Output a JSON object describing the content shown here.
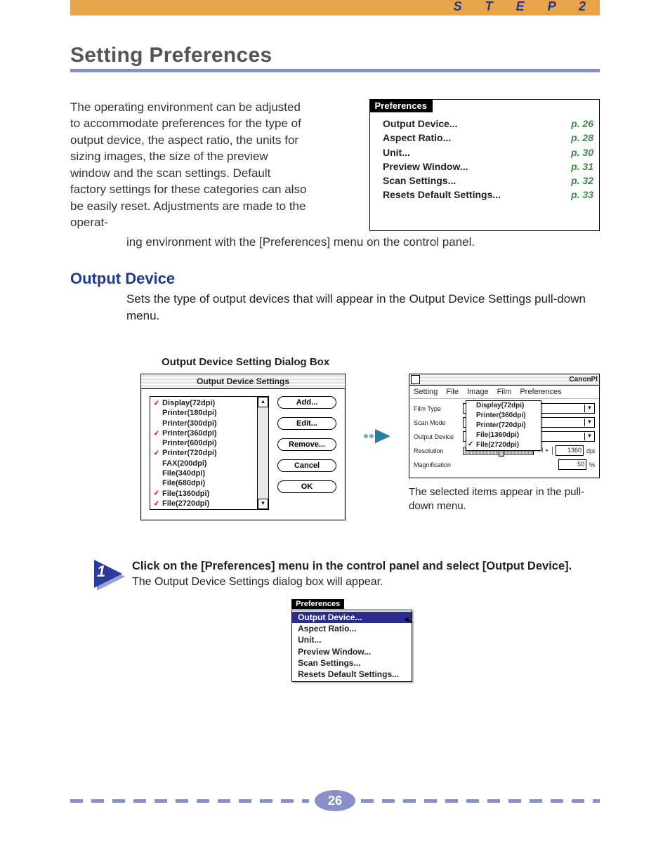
{
  "header": {
    "step_label": "S T E P  2",
    "title": "Setting Preferences"
  },
  "intro": {
    "para1": "The operating environment can be adjusted to accommodate preferences for the type of output device, the aspect ratio, the units for sizing images, the size of the preview window and the scan settings. Default factory settings for these categories can also be easily reset. Adjustments are made to the operat-",
    "para2": "ing environment with the [Preferences] menu on the control panel."
  },
  "pref_index": {
    "tab": "Preferences",
    "items": [
      {
        "label": "Output Device...",
        "page": "p. 26"
      },
      {
        "label": "Aspect Ratio...",
        "page": "p. 28"
      },
      {
        "label": "Unit...",
        "page": "p. 30"
      },
      {
        "label": "Preview Window...",
        "page": "p. 31"
      },
      {
        "label": "Scan Settings...",
        "page": "p. 32"
      },
      {
        "label": "Resets Default Settings...",
        "page": "p. 33"
      }
    ]
  },
  "subhead": {
    "title": "Output Device",
    "para": "Sets the type of output devices that will appear in the Output Device Settings pull-down menu."
  },
  "dialog": {
    "caption": "Output Device Setting Dialog Box",
    "title": "Output Device Settings",
    "items": [
      {
        "checked": true,
        "label": "Display(72dpi)"
      },
      {
        "checked": false,
        "label": "Printer(180dpi)"
      },
      {
        "checked": false,
        "label": "Printer(300dpi)"
      },
      {
        "checked": true,
        "label": "Printer(360dpi)"
      },
      {
        "checked": false,
        "label": "Printer(600dpi)"
      },
      {
        "checked": true,
        "label": "Printer(720dpi)"
      },
      {
        "checked": false,
        "label": "FAX(200dpi)"
      },
      {
        "checked": false,
        "label": "File(340dpi)"
      },
      {
        "checked": false,
        "label": "File(680dpi)"
      },
      {
        "checked": true,
        "label": "File(1360dpi)"
      },
      {
        "checked": true,
        "label": "File(2720dpi)"
      }
    ],
    "buttons": {
      "add": "Add...",
      "edit": "Edit...",
      "remove": "Remove...",
      "cancel": "Cancel",
      "ok": "OK"
    }
  },
  "panel": {
    "app": "CanonPl",
    "menus": [
      "Setting",
      "File",
      "Image",
      "Film",
      "Preferences"
    ],
    "rows": {
      "film_type": "Film Type",
      "scan_mode": "Scan Mode",
      "output_device": "Output Device",
      "resolution": "Resolution",
      "magnification": "Magnification"
    },
    "dropdown_items": [
      {
        "label": "Display(72dpi)",
        "sel": false
      },
      {
        "label": "Printer(360dpi)",
        "sel": false
      },
      {
        "label": "Printer(720dpi)",
        "sel": false
      },
      {
        "label": "File(1360dpi)",
        "sel": false
      },
      {
        "label": "File(2720dpi)",
        "sel": true
      }
    ],
    "res_value": "1360",
    "res_unit": "dpi",
    "mag_value": "50",
    "mag_unit": "%",
    "slider_seg": "◂ | ▸",
    "caption": "The selected items appear in the pull-down menu."
  },
  "step": {
    "num": "1",
    "bold": "Click on the [Preferences] menu in the control panel and select [Output Device].",
    "para": "The Output Device Settings dialog box will appear."
  },
  "pref_menu": {
    "tab": "Preferences",
    "items": [
      {
        "label": "Output Device...",
        "sel": true
      },
      {
        "label": "Aspect Ratio...",
        "sel": false
      },
      {
        "label": "Unit...",
        "sel": false
      },
      {
        "label": "Preview Window...",
        "sel": false
      },
      {
        "label": "Scan Settings...",
        "sel": false
      },
      {
        "label": "Resets Default Settings...",
        "sel": false
      }
    ]
  },
  "footer": {
    "page": "26"
  }
}
